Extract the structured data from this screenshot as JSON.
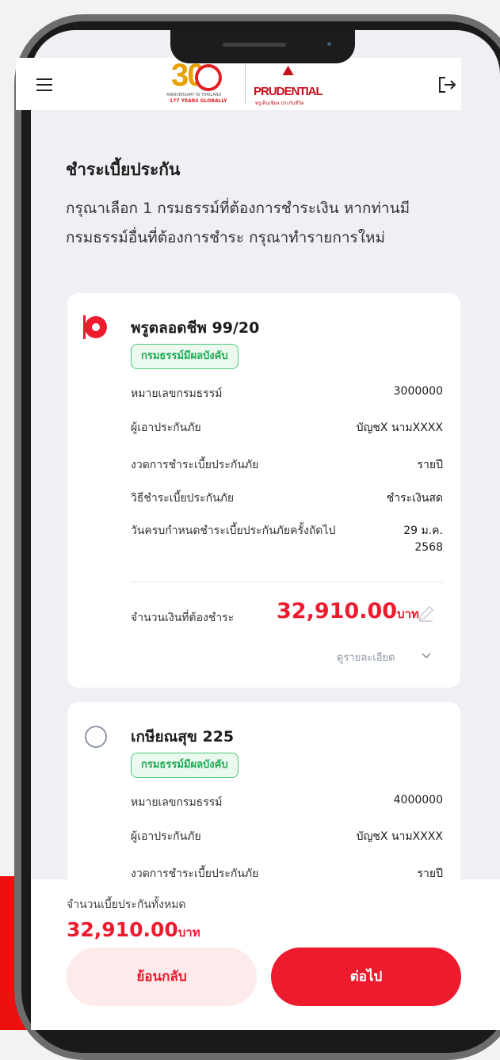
{
  "header": {
    "logo_30": {
      "number": "30",
      "tagline": "ANNIVERSARY IN THAILAND",
      "years": "177 YEARS GLOBALLY"
    },
    "logo_prudential": {
      "brand": "PRUDENTIAL",
      "tagline": "พรูเด็นเชียล ประกันชีวิต"
    },
    "icons": [
      "hamburger-menu-icon",
      "logout-icon"
    ]
  },
  "page": {
    "title": "ชำระเบี้ยประกัน",
    "description": "กรุณาเลือก 1 กรมธรรม์ที่ต้องการชำระเงิน หากท่านมีกรมธรรม์อื่นที่ต้องการชำระ กรุณาทำรายการใหม่"
  },
  "policies": [
    {
      "selected": true,
      "name": "พรูตลอดชีพ 99/20",
      "status": "กรมธรรม์มีผลบังคับ",
      "rows": [
        {
          "label": "หมายเลขกรมธรรม์",
          "value": "3000000"
        },
        {
          "label": "ผู้เอาประกันภัย",
          "value": "บัญชX นามXXXX"
        },
        {
          "label": "งวดการชำระเบี้ยประกันภัย",
          "value": "รายปี"
        },
        {
          "label": "วิธีชำระเบี้ยประกันภัย",
          "value": "ชำระเงินสด"
        },
        {
          "label": "วันครบกำหนดชำระเบี้ยประกันภัยครั้งถัดไป",
          "value": "29 ม.ค. 2568"
        }
      ],
      "amount_label": "จำนวนเงินที่ต้องชำระ",
      "amount": "32,910.00",
      "amount_unit": "บาท",
      "details_link": "ดูรายละเอียด"
    },
    {
      "selected": false,
      "name": "เกษียณสุข 225",
      "status": "กรมธรรม์มีผลบังคับ",
      "rows": [
        {
          "label": "หมายเลขกรมธรรม์",
          "value": "4000000"
        },
        {
          "label": "ผู้เอาประกันภัย",
          "value": "บัญชX นามXXXX"
        },
        {
          "label": "งวดการชำระเบี้ยประกันภัย",
          "value": "รายปี"
        }
      ]
    }
  ],
  "footer": {
    "total_label": "จำนวนเบี้ยประกันทั้งหมด",
    "total_amount": "32,910.00",
    "total_unit": "บาท",
    "back_button": "ย้อนกลับ",
    "next_button": "ต่อไป"
  },
  "colors": {
    "accent": "#ed1b2e",
    "success": "#1fab54",
    "screen_bg": "#eef0f4",
    "outer_red": "#ee0f0f"
  }
}
